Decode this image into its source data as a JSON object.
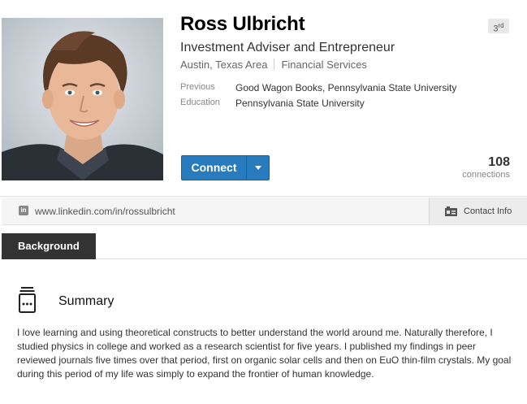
{
  "profile": {
    "name": "Ross Ulbricht",
    "headline": "Investment Adviser and Entrepreneur",
    "location": "Austin, Texas Area",
    "industry": "Financial Services",
    "degree": "3",
    "degree_suffix": "rd",
    "previous_label": "Previous",
    "previous_value": "Good Wagon Books, Pennsylvania State University",
    "education_label": "Education",
    "education_value": "Pennsylvania State University"
  },
  "actions": {
    "connect_label": "Connect",
    "connections_count": "108",
    "connections_label": "connections"
  },
  "url_bar": {
    "url": "www.linkedin.com/in/rossulbricht",
    "in_icon_text": "in",
    "contact_label": "Contact Info"
  },
  "background": {
    "tab_label": "Background",
    "summary_title": "Summary",
    "summary_text": "I love learning and using theoretical constructs to better understand the world around me. Naturally therefore, I studied physics in college and worked as a research scientist for five years. I published my findings in peer reviewed journals five times over that period, first on organic solar cells and then on EuO thin-film crystals. My goal during this period of my life was simply to expand the frontier of human knowledge."
  },
  "colors": {
    "connect_button": "#287bbc",
    "background_tab": "#333333"
  },
  "icons": [
    "profile-photo",
    "linkedin-in-icon",
    "contact-card-icon",
    "dropdown-caret-icon",
    "summary-box-icon"
  ]
}
